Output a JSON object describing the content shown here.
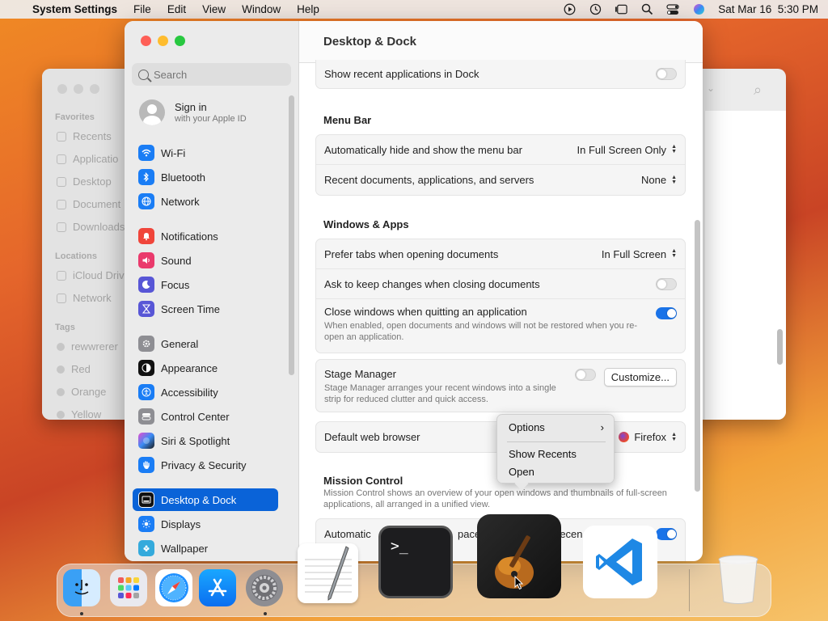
{
  "menubar": {
    "app_name": "System Settings",
    "menus": [
      "File",
      "Edit",
      "View",
      "Window",
      "Help"
    ],
    "datetime": "Sat Mar 16  5:30 PM"
  },
  "finder": {
    "sections": {
      "favorites": "Favorites",
      "locations": "Locations",
      "tags": "Tags"
    },
    "favorites": [
      "Recents",
      "Applicatio",
      "Desktop",
      "Document",
      "Downloads"
    ],
    "locations": [
      "iCloud Driv",
      "Network"
    ],
    "tags": [
      "rewwrerer",
      "Red",
      "Orange",
      "Yellow"
    ]
  },
  "settings": {
    "search_placeholder": "Search",
    "signin": {
      "title": "Sign in",
      "subtitle": "with your Apple ID"
    },
    "sidebar_items": [
      {
        "label": "Wi-Fi",
        "icon": "wifi-icon",
        "color": "#1a7df5"
      },
      {
        "label": "Bluetooth",
        "icon": "bluetooth-icon",
        "color": "#1a7df5"
      },
      {
        "label": "Network",
        "icon": "globe-icon",
        "color": "#1a7df5"
      },
      {
        "label": "Notifications",
        "icon": "bell-icon",
        "color": "#f0453a"
      },
      {
        "label": "Sound",
        "icon": "speaker-icon",
        "color": "#ea3a6c"
      },
      {
        "label": "Focus",
        "icon": "moon-icon",
        "color": "#5856d6"
      },
      {
        "label": "Screen Time",
        "icon": "hourglass-icon",
        "color": "#5856d6"
      },
      {
        "label": "General",
        "icon": "gear-icon",
        "color": "#8e8e93"
      },
      {
        "label": "Appearance",
        "icon": "appearance-icon",
        "color": "#111111"
      },
      {
        "label": "Accessibility",
        "icon": "accessibility-icon",
        "color": "#1a7df5"
      },
      {
        "label": "Control Center",
        "icon": "control-center-icon",
        "color": "#8e8e93"
      },
      {
        "label": "Siri & Spotlight",
        "icon": "siri-icon",
        "color": "#7b3fe4"
      },
      {
        "label": "Privacy & Security",
        "icon": "hand-icon",
        "color": "#1a7df5"
      },
      {
        "label": "Desktop & Dock",
        "icon": "dock-icon",
        "color": "#111111"
      },
      {
        "label": "Displays",
        "icon": "sun-icon",
        "color": "#1a7df5"
      },
      {
        "label": "Wallpaper",
        "icon": "wallpaper-icon",
        "color": "#34aadc"
      }
    ],
    "main": {
      "title": "Desktop & Dock",
      "recent_apps_label": "Show recent applications in Dock",
      "menu_bar_section": "Menu Bar",
      "auto_hide_label": "Automatically hide and show the menu bar",
      "auto_hide_value": "In Full Screen Only",
      "recent_docs_label": "Recent documents, applications, and servers",
      "recent_docs_value": "None",
      "windows_apps_section": "Windows & Apps",
      "prefer_tabs_label": "Prefer tabs when opening documents",
      "prefer_tabs_value": "In Full Screen",
      "ask_keep_label": "Ask to keep changes when closing documents",
      "close_windows_label": "Close windows when quitting an application",
      "close_windows_desc": "When enabled, open documents and windows will not be restored when you re-open an application.",
      "stage_manager_label": "Stage Manager",
      "stage_manager_desc": "Stage Manager arranges your recent windows into a single strip for reduced clutter and quick access.",
      "customize_button": "Customize...",
      "default_browser_label": "Default web browser",
      "default_browser_value": "Firefox",
      "mission_control_section": "Mission Control",
      "mission_control_desc": "Mission Control shows an overview of your open windows and thumbnails of full-screen applications, all arranged in a unified view.",
      "auto_rearrange_partial": "Automatic",
      "auto_rearrange_mid": "paces",
      "auto_rearrange_end": "recen"
    }
  },
  "context_menu": {
    "items": [
      "Options",
      "Show Recents",
      "Open"
    ]
  },
  "dock": {
    "apps": [
      "Finder",
      "Launchpad",
      "Safari",
      "App Store",
      "System Settings",
      "TextEdit",
      "Terminal",
      "GarageBand",
      "Visual Studio Code",
      "Trash"
    ]
  }
}
